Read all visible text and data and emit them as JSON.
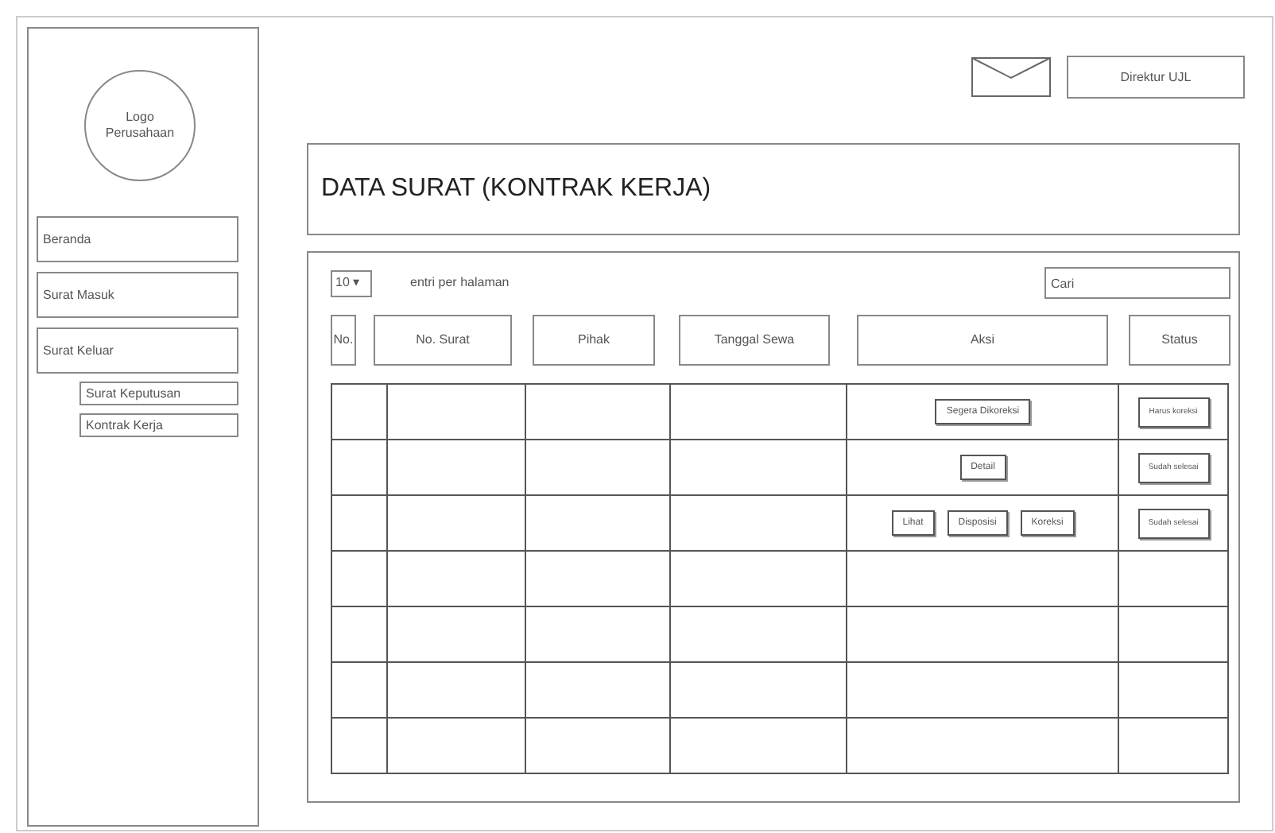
{
  "sidebar": {
    "logo": "Logo Perusahaan",
    "items": [
      {
        "label": "Beranda"
      },
      {
        "label": "Surat Masuk"
      },
      {
        "label": "Surat Keluar",
        "children": [
          {
            "label": "Surat Keputusan"
          },
          {
            "label": "Kontrak Kerja"
          }
        ]
      }
    ]
  },
  "header": {
    "user_button": "Direktur UJL"
  },
  "title": "DATA SURAT (KONTRAK KERJA)",
  "controls": {
    "page_size": "10 ▾",
    "page_size_label": "entri per halaman",
    "search": {
      "placeholder": "Cari"
    }
  },
  "table": {
    "columns": [
      "No.",
      "No. Surat",
      "Pihak",
      "Tanggal Sewa",
      "Aksi",
      "Status"
    ],
    "rows": [
      {
        "actions": [
          "Segera Dikoreksi"
        ],
        "status": "Harus koreksi"
      },
      {
        "actions": [
          "Detail"
        ],
        "status": "Sudah selesai"
      },
      {
        "actions": [
          "Lihat",
          "Disposisi",
          "Koreksi"
        ],
        "status": "Sudah selesai"
      },
      {},
      {},
      {},
      {}
    ]
  }
}
